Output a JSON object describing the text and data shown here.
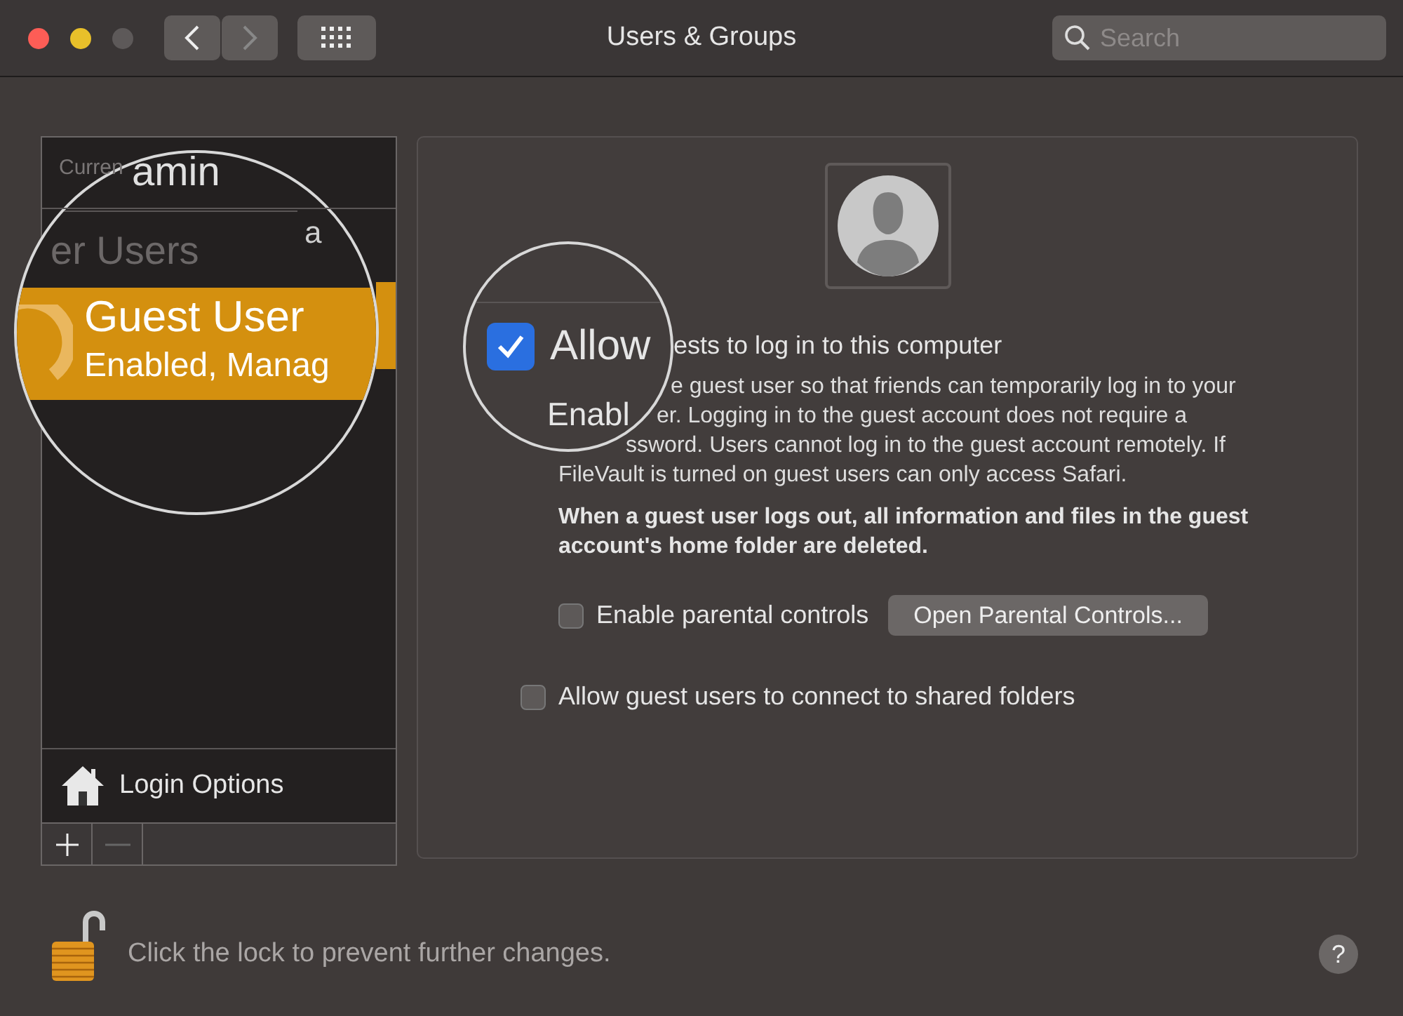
{
  "window": {
    "title": "Users & Groups"
  },
  "search": {
    "placeholder": "Search"
  },
  "users_list": {
    "current_label": "Curren",
    "magnified_name": "amin",
    "name_fragment": "a",
    "other_users_label": "er Users",
    "guest": {
      "name": "Guest User",
      "status": "Enabled, Manag",
      "selected": true
    },
    "login_options": "Login Options"
  },
  "guest_settings": {
    "allow_login": {
      "checked": true,
      "magnified_label": "Allow",
      "label_fragment": "ests to log in to this computer",
      "magnified_hint": "Enabl"
    },
    "description_lines": [
      "e guest user so that friends can temporarily log in to your",
      "er. Logging in to the guest account does not require a",
      "ssword. Users cannot log in to the guest account remotely. If",
      "FileVault is turned on guest users can only access Safari."
    ],
    "warning": "When a guest user logs out, all information and files in the guest account's home folder are deleted.",
    "parental_controls": {
      "label": "Enable parental controls",
      "checked": false,
      "button": "Open Parental Controls..."
    },
    "shared_folders": {
      "label": "Allow guest users to connect to shared folders",
      "checked": false
    }
  },
  "lock_message": "Click the lock to prevent further changes.",
  "help": "?"
}
